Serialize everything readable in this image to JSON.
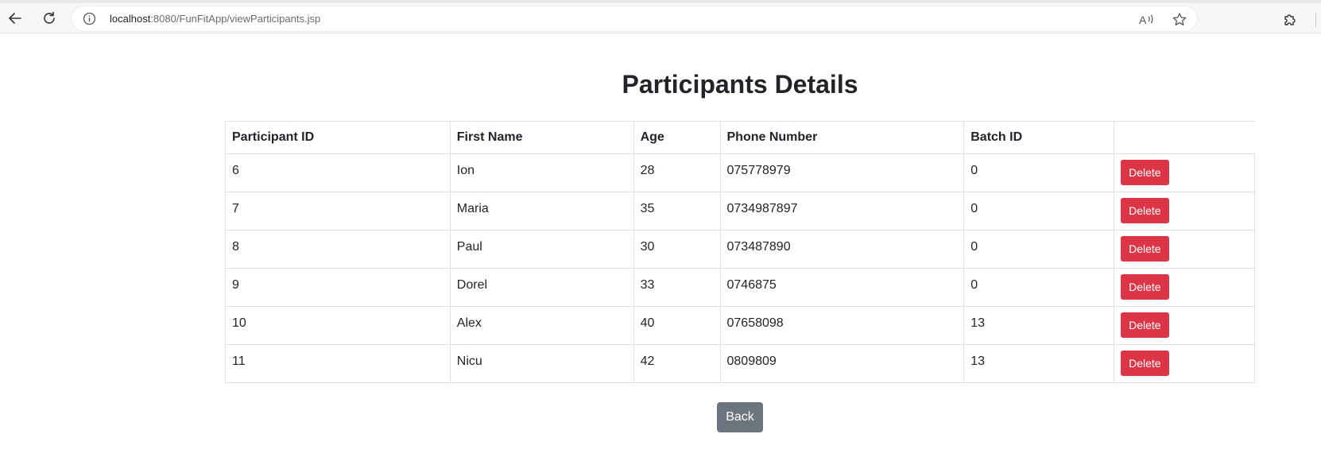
{
  "browser": {
    "url_host": "localhost",
    "url_rest": ":8080/FunFitApp/viewParticipants.jsp",
    "icons": {
      "back": "arrow-left-icon",
      "reload": "reload-icon",
      "info": "info-icon",
      "read_aloud": "read-aloud-icon",
      "favorite": "star-icon",
      "extensions": "puzzle-icon"
    }
  },
  "page": {
    "title": "Participants Details"
  },
  "table": {
    "headers": [
      "Participant ID",
      "First Name",
      "Age",
      "Phone Number",
      "Batch ID",
      ""
    ],
    "rows": [
      {
        "id": "6",
        "first_name": "Ion",
        "age": "28",
        "phone": "075778979",
        "batch_id": "0",
        "action": "Delete"
      },
      {
        "id": "7",
        "first_name": "Maria",
        "age": "35",
        "phone": "0734987897",
        "batch_id": "0",
        "action": "Delete"
      },
      {
        "id": "8",
        "first_name": "Paul",
        "age": "30",
        "phone": "073487890",
        "batch_id": "0",
        "action": "Delete"
      },
      {
        "id": "9",
        "first_name": "Dorel",
        "age": "33",
        "phone": "0746875",
        "batch_id": "0",
        "action": "Delete"
      },
      {
        "id": "10",
        "first_name": "Alex",
        "age": "40",
        "phone": "07658098",
        "batch_id": "13",
        "action": "Delete"
      },
      {
        "id": "11",
        "first_name": "Nicu",
        "age": "42",
        "phone": "0809809",
        "batch_id": "13",
        "action": "Delete"
      }
    ]
  },
  "actions": {
    "back_label": "Back"
  },
  "colors": {
    "danger": "#dc3545",
    "secondary": "#6c757d",
    "border": "#dee2e6",
    "text": "#212529"
  }
}
